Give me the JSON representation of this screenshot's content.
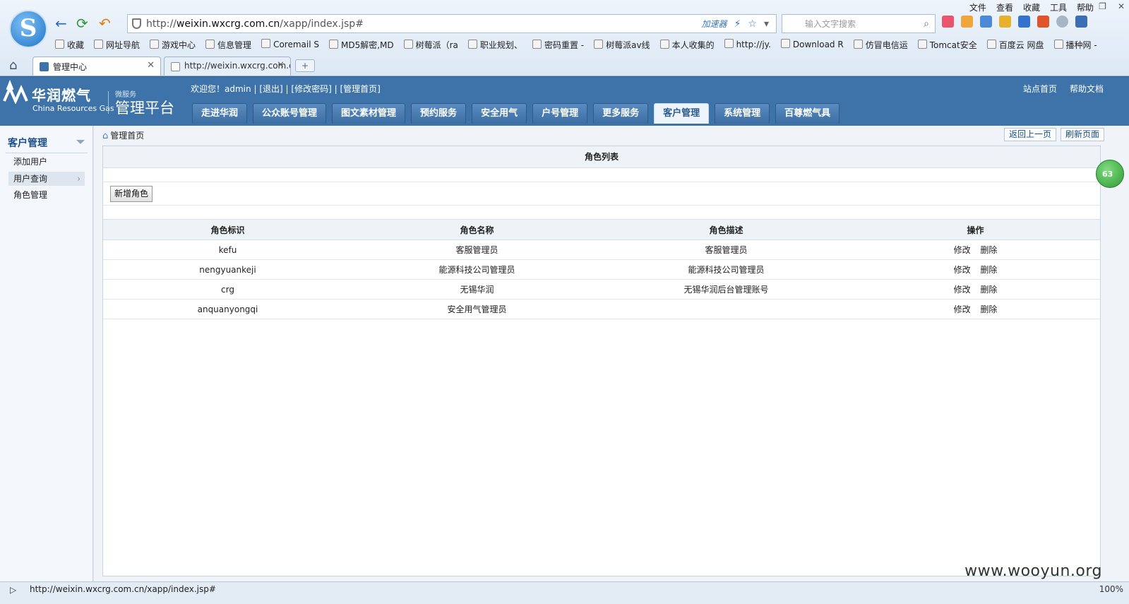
{
  "browser": {
    "menu": [
      "文件",
      "查看",
      "收藏",
      "工具",
      "帮助"
    ],
    "url_prefix": "http://",
    "url_domain": "weixin.wxcrg.com.cn",
    "url_path": "/xapp/index.jsp#",
    "accelerator": "加速器",
    "search_placeholder": "输入文字搜索",
    "bookmarks": [
      "收藏",
      "网址导航",
      "游戏中心",
      "信息管理",
      "Coremail S",
      "MD5解密,MD",
      "树莓派（ra",
      "职业规划、",
      "密码重置 -",
      "树莓派av线",
      "本人收集的",
      "http://jy.",
      "Download R",
      "仿冒电信运",
      "Tomcat安全",
      "百度云 网盘",
      "播种网 -"
    ],
    "tabs": [
      {
        "label": "管理中心"
      },
      {
        "label": "http://weixin.wxcrg.com.cn"
      }
    ],
    "status_url": "http://weixin.wxcrg.com.cn/xapp/index.jsp#",
    "zoom": "100%"
  },
  "header": {
    "brand_cn": "华润燃气",
    "brand_en": "China Resources Gas",
    "sub_small": "微服务",
    "sub_title": "管理平台",
    "welcome_prefix": "欢迎您！admin",
    "logout": "[退出]",
    "change_password": "[修改密码]",
    "home": "[管理首页]",
    "sep": "|",
    "site_home": "站点首页",
    "help_docs": "帮助文档",
    "nav": [
      "走进华润",
      "公众账号管理",
      "图文素材管理",
      "预约服务",
      "安全用气",
      "户号管理",
      "更多服务",
      "客户管理",
      "系统管理",
      "百尊燃气具"
    ]
  },
  "sidebar": {
    "title": "客户管理",
    "items": [
      "添加用户",
      "用户查询",
      "角色管理"
    ]
  },
  "content": {
    "breadcrumb": "管理首页",
    "back_button": "返回上一页",
    "refresh_button": "刷新页面",
    "panel_title": "角色列表",
    "add_button": "新增角色",
    "columns": [
      "角色标识",
      "角色名称",
      "角色描述",
      "操作"
    ],
    "rows": [
      {
        "id": "kefu",
        "name": "客服管理员",
        "desc": "客服管理员"
      },
      {
        "id": "nengyuankeji",
        "name": "能源科技公司管理员",
        "desc": "能源科技公司管理员"
      },
      {
        "id": "crg",
        "name": "无锡华润",
        "desc": "无锡华润后台管理账号"
      },
      {
        "id": "anquanyongqi",
        "name": "安全用气管理员",
        "desc": ""
      }
    ],
    "edit_label": "修改",
    "delete_label": "删除"
  },
  "bubble": "63",
  "watermark": "www.wooyun.org",
  "colors": {
    "header_bg": "#3e73a9",
    "nav_active_bg": "#eef4fb",
    "sidebar_title": "#1d4f86"
  }
}
